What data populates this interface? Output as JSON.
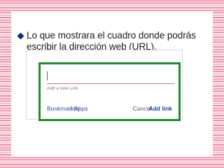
{
  "slide": {
    "bullet_text": "Lo que mostrara el cuadro donde podrás escribir la dirección web (URL)."
  },
  "dialog": {
    "url_input": {
      "value": "",
      "hint": "Add a new Link"
    },
    "bookmarklet_label": "Bookmarklet",
    "separator": "|",
    "apps_label": "Apps",
    "cancel_label": "Cancel",
    "add_link_label": "Add link"
  },
  "colors": {
    "highlight_border": "#1f8a2e",
    "link": "#3949ab",
    "bullet": "#0b2a8c"
  }
}
